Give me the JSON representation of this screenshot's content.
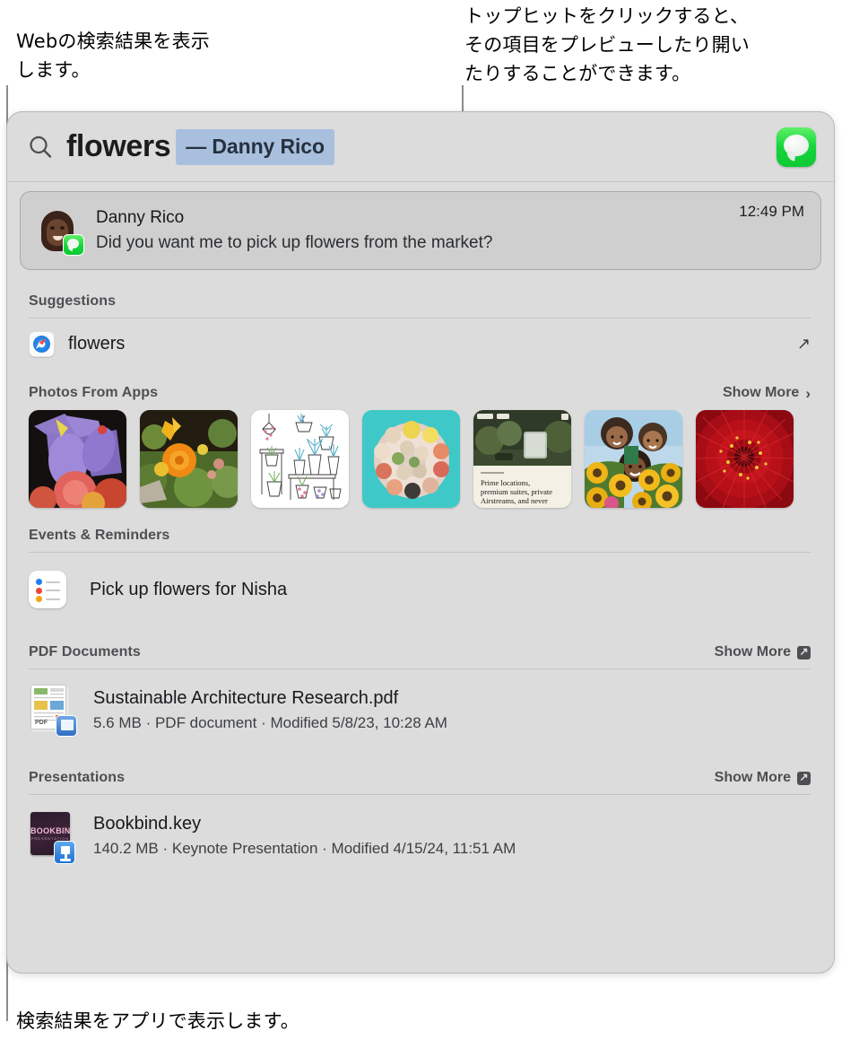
{
  "annotations": {
    "web_results": "Webの検索結果を表示\nします。",
    "top_hit": "トップヒットをクリックすると、\nその項目をプレビューしたり開い\nたりすることができます。",
    "app_results": "検索結果をアプリで表示します。"
  },
  "search": {
    "query": "flowers",
    "completion": "—  Danny Rico",
    "magnifier_icon": "search-icon",
    "app_icon": "messages-icon"
  },
  "top_hit": {
    "title": "Danny Rico",
    "message": "Did you want me to pick up flowers from the market?",
    "time": "12:49 PM",
    "badge_icon": "messages-badge-icon",
    "avatar_icon": "memoji-avatar"
  },
  "sections": [
    {
      "id": "suggestions",
      "title": "Suggestions",
      "show_more": null,
      "rows": [
        {
          "icon": "safari-icon",
          "label": "flowers",
          "trailing_icon": "open-external-arrow-icon"
        }
      ]
    },
    {
      "id": "photos-from-apps",
      "title": "Photos From Apps",
      "show_more": {
        "label": "Show More",
        "icon": "chevron-right-icon"
      },
      "photos": [
        {
          "alt": "purple-iris-flowers"
        },
        {
          "alt": "orange-marigold-in-garden"
        },
        {
          "alt": "houseplants-line-illustration"
        },
        {
          "alt": "sushi-platter-on-teal"
        },
        {
          "alt": "web-article-garden-airstream",
          "caption": "Prime locations,\npremium suites, private\nAirstreams, and never"
        },
        {
          "alt": "three-people-with-sunflowers"
        },
        {
          "alt": "red-gerbera-daisy-closeup"
        }
      ]
    },
    {
      "id": "events-reminders",
      "title": "Events & Reminders",
      "show_more": null,
      "rows": [
        {
          "icon": "reminders-icon",
          "label": "Pick up flowers for Nisha"
        }
      ]
    },
    {
      "id": "pdf-documents",
      "title": "PDF Documents",
      "show_more": {
        "label": "Show More",
        "icon": "open-external-badge-icon"
      },
      "files": [
        {
          "icon": "pdf-file-icon",
          "name": "Sustainable Architecture Research.pdf",
          "meta": "5.6 MB · PDF document · Modified 5/8/23, 10:28 AM"
        }
      ]
    },
    {
      "id": "presentations",
      "title": "Presentations",
      "show_more": {
        "label": "Show More",
        "icon": "open-external-badge-icon"
      },
      "files": [
        {
          "icon": "keynote-file-icon",
          "name": "Bookbind.key",
          "meta": "140.2 MB · Keynote Presentation · Modified 4/15/24, 11:51 AM"
        }
      ]
    }
  ],
  "colors": {
    "window_bg": "#dcdcdc",
    "completion_highlight": "#a8c0de",
    "messages_green": "#16d63c",
    "safari_blue": "#2b8df0",
    "leader_line": "#8c8c8c"
  }
}
